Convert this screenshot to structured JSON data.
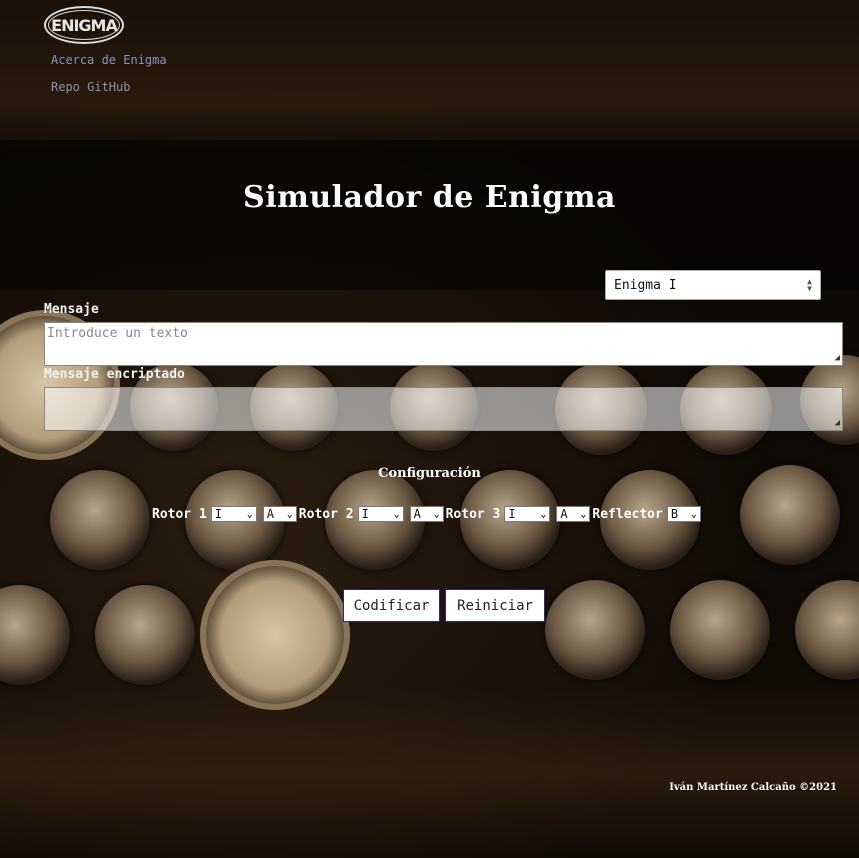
{
  "header": {
    "logo_text": "ENIGMA",
    "nav": [
      {
        "label": "Acerca de Enigma"
      },
      {
        "label": "Repo GitHub"
      }
    ]
  },
  "main": {
    "title": "Simulador de Enigma",
    "model_select": {
      "value": "Enigma I"
    },
    "message": {
      "label": "Mensaje",
      "placeholder": "Introduce un texto",
      "value": ""
    },
    "encrypted": {
      "label": "Mensaje encriptado",
      "value": ""
    },
    "config": {
      "title": "Configuración",
      "rotors": [
        {
          "label": "Rotor 1",
          "rotor": "I",
          "position": "A"
        },
        {
          "label": "Rotor 2",
          "rotor": "I",
          "position": "A"
        },
        {
          "label": "Rotor 3",
          "rotor": "I",
          "position": "A"
        }
      ],
      "reflector": {
        "label": "Reflector",
        "value": "B"
      }
    },
    "buttons": {
      "encode": "Codificar",
      "reset": "Reiniciar"
    }
  },
  "footer": {
    "text": "Iván Martínez Calcaño ©2021"
  },
  "colors": {
    "link": "#8a93b8",
    "button_border": "#2a2a7a"
  }
}
